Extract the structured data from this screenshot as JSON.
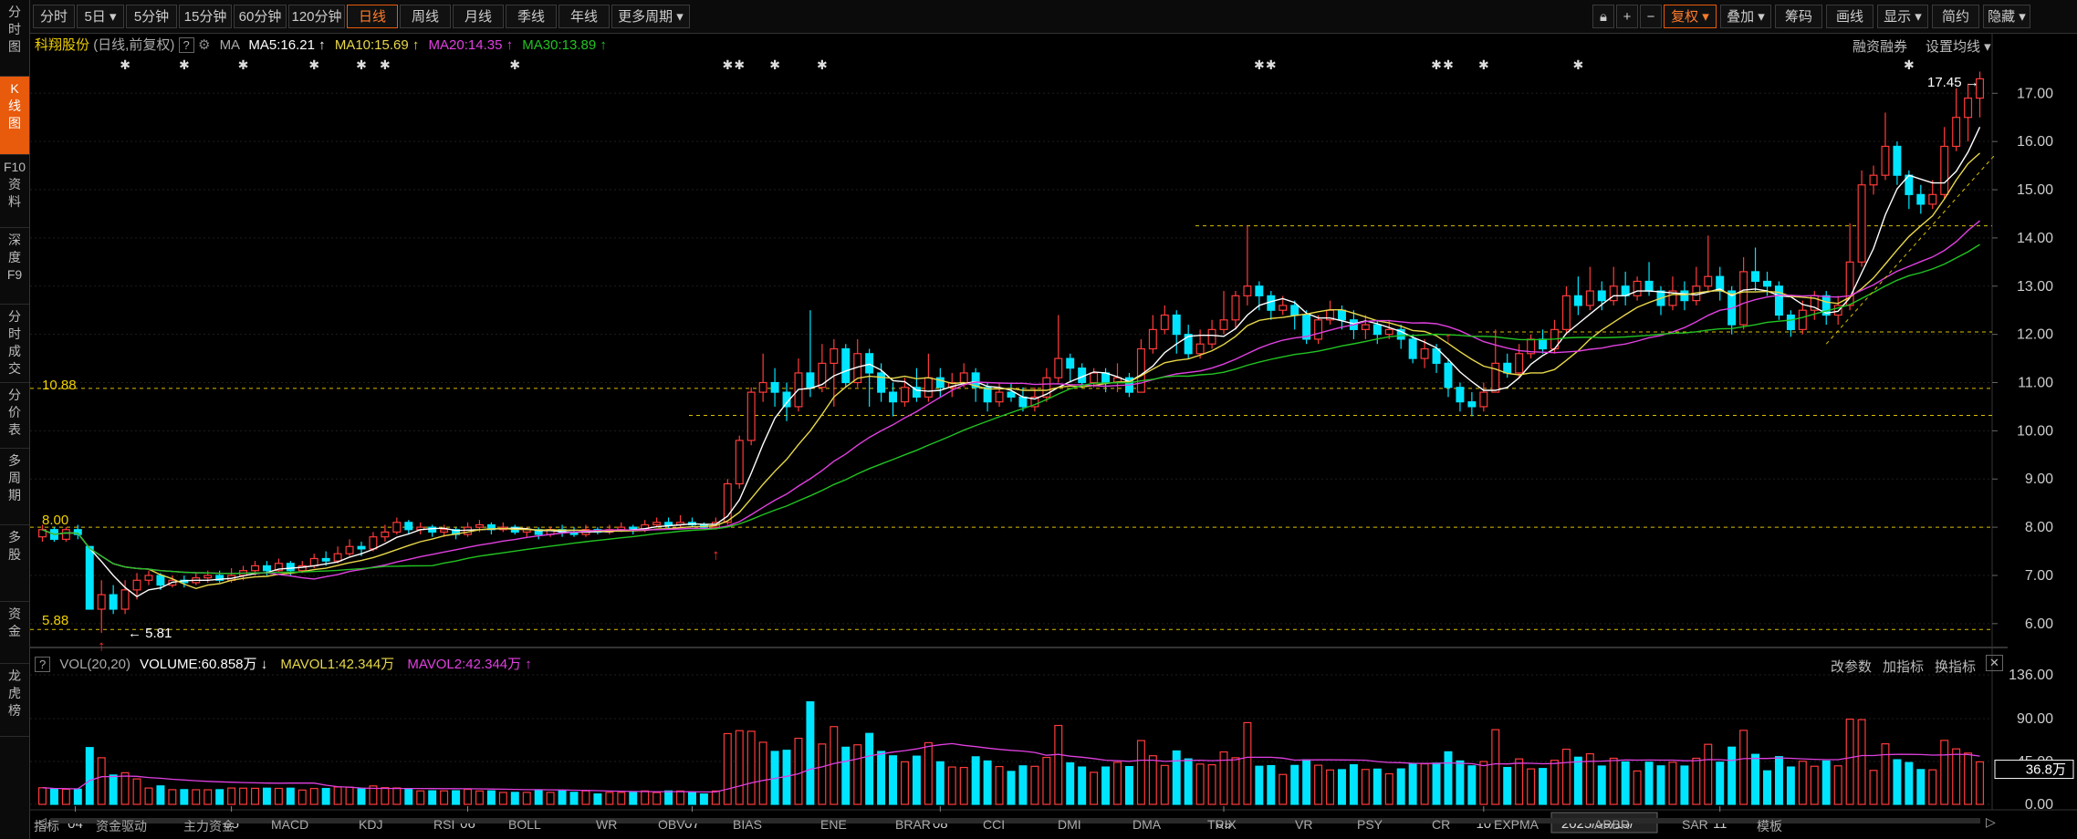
{
  "sidebar": {
    "items": [
      {
        "label": "分\n时\n图",
        "active": false
      },
      {
        "label": "K\n线\n图",
        "active": true
      },
      {
        "label": "F10\n资\n料",
        "active": false
      },
      {
        "label": "深\n度\nF9",
        "active": false
      },
      {
        "label": "分\n时\n成\n交",
        "active": false
      },
      {
        "label": "分\n价\n表",
        "active": false
      },
      {
        "label": "多\n周\n期",
        "active": false
      },
      {
        "label": "多\n股",
        "active": false
      },
      {
        "label": "资\n金",
        "active": false
      },
      {
        "label": "龙\n虎\n榜",
        "active": false
      }
    ]
  },
  "toolbar": {
    "periods": [
      "分时",
      "5日",
      "5分钟",
      "15分钟",
      "60分钟",
      "120分钟",
      "日线",
      "周线",
      "月线",
      "季线",
      "年线",
      "更多周期"
    ],
    "active_period": "日线",
    "right_buttons": [
      "复权",
      "叠加",
      "筹码",
      "画线",
      "显示",
      "简约",
      "隐藏"
    ],
    "right_icons": [
      "lock-icon",
      "plus-icon",
      "minus-icon"
    ]
  },
  "legend": {
    "stock_name": "科翔股份",
    "stock_mode": "(日线,前复权)",
    "help": "?",
    "ma_label": "MA",
    "ma5": "MA5:16.21",
    "ma10": "MA10:15.69",
    "ma20": "MA20:14.35",
    "ma30": "MA30:13.89",
    "right_links": [
      "融资融券",
      "设置均线"
    ],
    "ma_colors": {
      "ma5": "#ffffff",
      "ma10": "#e8d84a",
      "ma20": "#e040e0",
      "ma30": "#22c322"
    }
  },
  "annotations": {
    "high_label": "17.45",
    "low_label": "5.81",
    "line_10_88": "10.88",
    "line_8_00": "8.00",
    "line_5_88": "5.88"
  },
  "volume_legend": {
    "help": "?",
    "label": "VOL(20,20)",
    "volume": "VOLUME:60.858万",
    "mavol1": "MAVOL1:42.344万",
    "mavol2": "MAVOL2:42.344万",
    "right_links": [
      "改参数",
      "加指标",
      "换指标"
    ],
    "close": "✕"
  },
  "volume_axis": {
    "ticks": [
      "136.00",
      "90.00",
      "45.00",
      "0.00"
    ],
    "current": "36.8万"
  },
  "price_axis": {
    "ticks": [
      "17.00",
      "16.00",
      "15.00",
      "14.00",
      "13.00",
      "12.00",
      "11.00",
      "10.00",
      "9.00",
      "8.00",
      "7.00",
      "6.00"
    ]
  },
  "time_axis": {
    "labels": [
      "04",
      "05",
      "06",
      "07",
      "08",
      "09",
      "10",
      "11"
    ],
    "current_date": "2025/09/15/一"
  },
  "bottom_tabs": {
    "items": [
      "指标",
      "资金驱动",
      "主力资金",
      "MACD",
      "KDJ",
      "RSI",
      "BOLL",
      "WR",
      "OBV",
      "BIAS",
      "ENE",
      "BRAR",
      "CCI",
      "DMI",
      "DMA",
      "TRIX",
      "VR",
      "PSY",
      "CR",
      "EXPMA",
      "ARBR",
      "SAR",
      "模板"
    ]
  },
  "chart_data": {
    "type": "candlestick",
    "title": "科翔股份 (日线,前复权)",
    "period": "daily",
    "ylim": [
      5.6,
      17.8
    ],
    "x_axis_months": [
      "04",
      "05",
      "06",
      "07",
      "08",
      "09",
      "10",
      "11"
    ],
    "price_lines": [
      10.88,
      8.0,
      5.88,
      10.32,
      12.05,
      14.25
    ],
    "high": 17.45,
    "low": 5.81,
    "ma_values": {
      "MA5": 16.21,
      "MA10": 15.69,
      "MA20": 14.35,
      "MA30": 13.89
    },
    "candles": [
      [
        7.8,
        7.95,
        8.05,
        7.7
      ],
      [
        7.95,
        7.75,
        8.0,
        7.7
      ],
      [
        7.75,
        7.95,
        8.0,
        7.7
      ],
      [
        7.95,
        7.85,
        8.05,
        7.75
      ],
      [
        7.6,
        6.3,
        7.6,
        6.3
      ],
      [
        6.3,
        6.6,
        6.9,
        5.81
      ],
      [
        6.6,
        6.3,
        6.8,
        6.2
      ],
      [
        6.3,
        6.7,
        6.9,
        6.2
      ],
      [
        6.7,
        6.9,
        7.05,
        6.5
      ],
      [
        6.9,
        7.0,
        7.1,
        6.8
      ],
      [
        7.0,
        6.8,
        7.05,
        6.7
      ],
      [
        6.8,
        6.9,
        7.0,
        6.75
      ],
      [
        6.9,
        6.85,
        7.0,
        6.75
      ],
      [
        6.85,
        6.95,
        7.05,
        6.8
      ],
      [
        6.95,
        7.0,
        7.1,
        6.85
      ],
      [
        7.0,
        6.9,
        7.1,
        6.85
      ],
      [
        6.9,
        7.0,
        7.15,
        6.85
      ],
      [
        7.0,
        7.1,
        7.2,
        6.9
      ],
      [
        7.1,
        7.2,
        7.3,
        7.0
      ],
      [
        7.2,
        7.1,
        7.3,
        7.0
      ],
      [
        7.1,
        7.25,
        7.35,
        7.05
      ],
      [
        7.25,
        7.1,
        7.3,
        7.0
      ],
      [
        7.1,
        7.2,
        7.3,
        7.05
      ],
      [
        7.2,
        7.35,
        7.45,
        7.15
      ],
      [
        7.35,
        7.3,
        7.5,
        7.2
      ],
      [
        7.3,
        7.45,
        7.6,
        7.25
      ],
      [
        7.45,
        7.6,
        7.75,
        7.4
      ],
      [
        7.6,
        7.55,
        7.7,
        7.4
      ],
      [
        7.55,
        7.8,
        7.9,
        7.5
      ],
      [
        7.8,
        7.9,
        8.05,
        7.7
      ],
      [
        7.9,
        8.1,
        8.2,
        7.85
      ],
      [
        8.1,
        7.95,
        8.15,
        7.85
      ],
      [
        7.95,
        8.0,
        8.1,
        7.85
      ],
      [
        8.0,
        7.9,
        8.05,
        7.8
      ],
      [
        7.9,
        7.95,
        8.05,
        7.8
      ],
      [
        7.95,
        7.85,
        8.0,
        7.75
      ],
      [
        7.85,
        8.0,
        8.1,
        7.8
      ],
      [
        8.0,
        8.05,
        8.15,
        7.9
      ],
      [
        8.05,
        7.95,
        8.1,
        7.85
      ],
      [
        7.95,
        8.0,
        8.1,
        7.9
      ],
      [
        8.0,
        7.9,
        8.05,
        7.85
      ],
      [
        7.9,
        7.95,
        8.0,
        7.8
      ],
      [
        7.95,
        7.85,
        8.0,
        7.75
      ],
      [
        7.85,
        7.95,
        8.0,
        7.8
      ],
      [
        7.95,
        7.9,
        8.05,
        7.8
      ],
      [
        7.9,
        7.85,
        8.0,
        7.8
      ],
      [
        7.85,
        7.95,
        8.05,
        7.8
      ],
      [
        7.95,
        7.9,
        8.0,
        7.85
      ],
      [
        7.9,
        7.95,
        8.05,
        7.85
      ],
      [
        7.95,
        8.0,
        8.1,
        7.9
      ],
      [
        8.0,
        7.95,
        8.05,
        7.85
      ],
      [
        7.95,
        8.05,
        8.15,
        7.9
      ],
      [
        8.05,
        8.1,
        8.2,
        8.0
      ],
      [
        8.1,
        8.05,
        8.2,
        7.95
      ],
      [
        8.05,
        8.1,
        8.25,
        8.0
      ],
      [
        8.1,
        8.05,
        8.2,
        8.0
      ],
      [
        8.05,
        8.0,
        8.1,
        7.95
      ],
      [
        8.0,
        8.1,
        8.2,
        7.95
      ],
      [
        8.1,
        8.9,
        9.0,
        8.05
      ],
      [
        8.9,
        9.8,
        9.9,
        8.8
      ],
      [
        9.8,
        10.8,
        10.9,
        9.7
      ],
      [
        10.8,
        11.0,
        11.6,
        10.6
      ],
      [
        11.0,
        10.8,
        11.3,
        10.5
      ],
      [
        10.8,
        10.5,
        11.0,
        10.2
      ],
      [
        10.5,
        11.2,
        11.5,
        10.4
      ],
      [
        11.2,
        10.9,
        12.5,
        10.7
      ],
      [
        10.9,
        11.4,
        11.8,
        10.8
      ],
      [
        11.4,
        11.7,
        11.9,
        10.5
      ],
      [
        11.7,
        11.0,
        11.8,
        10.9
      ],
      [
        11.0,
        11.6,
        11.9,
        10.9
      ],
      [
        11.6,
        11.2,
        11.7,
        10.5
      ],
      [
        11.2,
        10.8,
        11.4,
        10.6
      ],
      [
        10.8,
        10.6,
        11.0,
        10.3
      ],
      [
        10.6,
        10.9,
        11.1,
        10.5
      ],
      [
        10.9,
        10.7,
        11.3,
        10.6
      ],
      [
        10.7,
        11.1,
        11.6,
        10.6
      ],
      [
        11.1,
        10.9,
        11.3,
        10.7
      ],
      [
        10.9,
        11.0,
        11.2,
        10.7
      ],
      [
        11.0,
        11.2,
        11.4,
        10.9
      ],
      [
        11.2,
        10.9,
        11.3,
        10.6
      ],
      [
        10.9,
        10.6,
        11.0,
        10.4
      ],
      [
        10.6,
        10.8,
        11.0,
        10.5
      ],
      [
        10.8,
        10.7,
        11.0,
        10.6
      ],
      [
        10.7,
        10.5,
        10.9,
        10.4
      ],
      [
        10.5,
        10.7,
        10.9,
        10.4
      ],
      [
        10.7,
        11.1,
        11.3,
        10.6
      ],
      [
        11.1,
        11.5,
        12.4,
        11.0
      ],
      [
        11.5,
        11.3,
        11.6,
        11.0
      ],
      [
        11.3,
        11.0,
        11.4,
        10.9
      ],
      [
        11.0,
        11.2,
        11.3,
        10.9
      ],
      [
        11.2,
        11.0,
        11.3,
        10.8
      ],
      [
        11.0,
        11.1,
        11.4,
        10.8
      ],
      [
        11.1,
        10.8,
        11.2,
        10.7
      ],
      [
        10.8,
        11.7,
        11.9,
        10.8
      ],
      [
        11.7,
        12.1,
        12.4,
        11.6
      ],
      [
        12.1,
        12.4,
        12.6,
        12.0
      ],
      [
        12.4,
        12.0,
        12.5,
        11.6
      ],
      [
        12.0,
        11.6,
        12.2,
        11.5
      ],
      [
        11.6,
        11.8,
        12.1,
        11.5
      ],
      [
        11.8,
        12.1,
        12.3,
        11.7
      ],
      [
        12.1,
        12.3,
        12.9,
        12.0
      ],
      [
        12.3,
        12.8,
        12.9,
        12.1
      ],
      [
        12.8,
        13.0,
        14.25,
        12.6
      ],
      [
        13.0,
        12.8,
        13.1,
        12.5
      ],
      [
        12.8,
        12.5,
        12.9,
        12.3
      ],
      [
        12.5,
        12.6,
        12.8,
        12.4
      ],
      [
        12.6,
        12.4,
        12.7,
        12.1
      ],
      [
        12.4,
        11.9,
        12.5,
        11.8
      ],
      [
        11.9,
        12.3,
        12.4,
        11.8
      ],
      [
        12.3,
        12.5,
        12.7,
        12.2
      ],
      [
        12.5,
        12.3,
        12.6,
        12.1
      ],
      [
        12.3,
        12.1,
        12.5,
        11.9
      ],
      [
        12.1,
        12.2,
        12.4,
        11.9
      ],
      [
        12.2,
        12.0,
        12.3,
        11.8
      ],
      [
        12.0,
        12.1,
        12.3,
        11.9
      ],
      [
        12.1,
        11.9,
        12.2,
        11.7
      ],
      [
        11.9,
        11.5,
        12.0,
        11.4
      ],
      [
        11.5,
        11.7,
        11.9,
        11.3
      ],
      [
        11.7,
        11.4,
        11.8,
        11.2
      ],
      [
        11.4,
        10.9,
        11.5,
        10.7
      ],
      [
        10.9,
        10.6,
        11.0,
        10.4
      ],
      [
        10.6,
        10.5,
        10.8,
        10.3
      ],
      [
        10.5,
        10.8,
        11.0,
        10.4
      ],
      [
        10.8,
        11.4,
        12.1,
        10.8
      ],
      [
        11.4,
        11.2,
        11.6,
        11.1
      ],
      [
        11.2,
        11.6,
        11.8,
        11.1
      ],
      [
        11.6,
        11.9,
        12.0,
        11.5
      ],
      [
        11.9,
        11.7,
        12.1,
        11.6
      ],
      [
        11.7,
        12.1,
        12.3,
        11.6
      ],
      [
        12.1,
        12.8,
        13.0,
        12.0
      ],
      [
        12.8,
        12.6,
        13.2,
        12.4
      ],
      [
        12.6,
        12.9,
        13.4,
        12.5
      ],
      [
        12.9,
        12.7,
        13.1,
        12.5
      ],
      [
        12.7,
        13.0,
        13.4,
        12.6
      ],
      [
        13.0,
        12.8,
        13.3,
        12.6
      ],
      [
        12.8,
        13.1,
        13.2,
        12.7
      ],
      [
        13.1,
        12.9,
        13.5,
        12.8
      ],
      [
        12.9,
        12.6,
        13.0,
        12.4
      ],
      [
        12.6,
        12.9,
        13.2,
        12.5
      ],
      [
        12.9,
        12.7,
        13.1,
        12.5
      ],
      [
        12.7,
        13.0,
        13.4,
        12.6
      ],
      [
        13.0,
        13.2,
        14.05,
        12.9
      ],
      [
        13.2,
        12.9,
        13.4,
        12.7
      ],
      [
        12.9,
        12.2,
        13.0,
        12.0
      ],
      [
        12.2,
        13.3,
        13.6,
        12.1
      ],
      [
        13.3,
        13.1,
        13.8,
        12.9
      ],
      [
        13.1,
        13.0,
        13.3,
        12.8
      ],
      [
        13.0,
        12.4,
        13.1,
        12.3
      ],
      [
        12.4,
        12.1,
        12.5,
        11.95
      ],
      [
        12.1,
        12.5,
        12.7,
        12.0
      ],
      [
        12.5,
        12.8,
        12.9,
        12.3
      ],
      [
        12.8,
        12.4,
        12.9,
        12.2
      ],
      [
        12.4,
        12.6,
        12.8,
        12.2
      ],
      [
        12.6,
        13.5,
        14.3,
        12.5
      ],
      [
        13.5,
        15.1,
        15.4,
        13.4
      ],
      [
        15.1,
        15.3,
        15.5,
        14.9
      ],
      [
        15.3,
        15.9,
        16.6,
        15.2
      ],
      [
        15.9,
        15.3,
        16.0,
        15.1
      ],
      [
        15.3,
        14.9,
        15.4,
        14.6
      ],
      [
        14.9,
        14.7,
        15.1,
        14.5
      ],
      [
        14.7,
        14.9,
        15.2,
        14.6
      ],
      [
        14.9,
        15.9,
        16.3,
        14.8
      ],
      [
        15.9,
        16.5,
        17.1,
        15.8
      ],
      [
        16.5,
        16.9,
        17.2,
        16.0
      ],
      [
        16.9,
        17.3,
        17.45,
        16.5
      ]
    ]
  }
}
